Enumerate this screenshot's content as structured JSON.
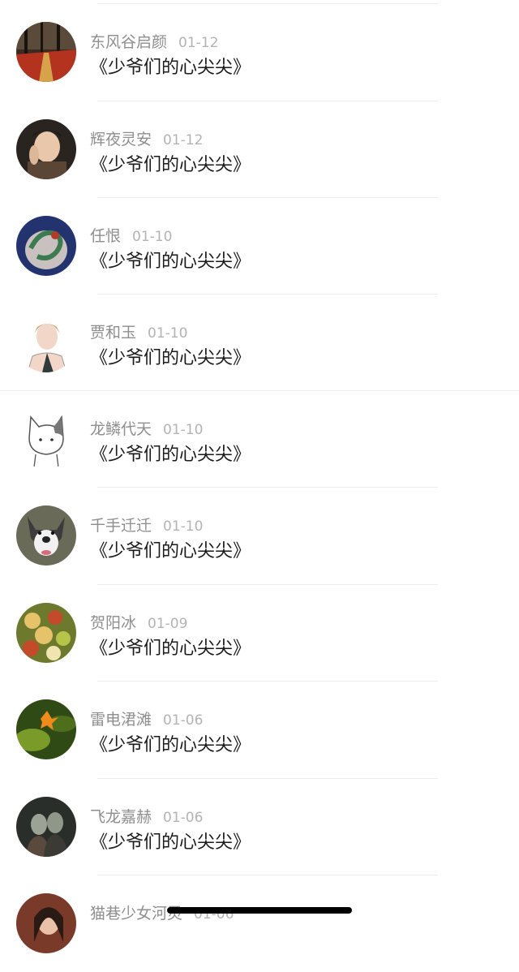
{
  "comments": [
    {
      "name": "东风谷启颜",
      "date": "01-12",
      "title": "《少爷们的心尖尖》",
      "avatar": "autumn-path-avatar",
      "colors": [
        "#3b2a1f",
        "#b3331f",
        "#d7a34a"
      ]
    },
    {
      "name": "辉夜灵安",
      "date": "01-12",
      "title": "《少爷们的心尖尖》",
      "avatar": "man-portrait-avatar",
      "colors": [
        "#2a2420",
        "#e8c7aa",
        "#5b4636"
      ]
    },
    {
      "name": "任恨",
      "date": "01-10",
      "title": "《少爷们的心尖尖》",
      "avatar": "dragon-ornament-avatar",
      "colors": [
        "#23336f",
        "#c8c1c0",
        "#3c7a4f"
      ]
    },
    {
      "name": "贾和玉",
      "date": "01-10",
      "title": "《少爷们的心尖尖》",
      "avatar": "anime-boy-avatar",
      "colors": [
        "#ffffff",
        "#cfa77e",
        "#f2d7c8"
      ]
    },
    {
      "name": "龙鳞代天",
      "date": "01-10",
      "title": "《少爷们的心尖尖》",
      "avatar": "cat-sketch-avatar",
      "colors": [
        "#ffffff",
        "#777777",
        "#cfcfcf"
      ]
    },
    {
      "name": "千手迁迁",
      "date": "01-10",
      "title": "《少爷们的心尖尖》",
      "avatar": "husky-dog-avatar",
      "colors": [
        "#6a6a58",
        "#f1f1f1",
        "#3b3b3b"
      ]
    },
    {
      "name": "贺阳冰",
      "date": "01-09",
      "title": "《少爷们的心尖尖》",
      "avatar": "food-platter-avatar",
      "colors": [
        "#6d7a2e",
        "#e6c36a",
        "#c44a2c"
      ]
    },
    {
      "name": "雷电涒滩",
      "date": "01-06",
      "title": "《少爷们的心尖尖》",
      "avatar": "green-leaf-avatar",
      "colors": [
        "#2f4a14",
        "#7a9a2a",
        "#f08a1b"
      ]
    },
    {
      "name": "飞龙嘉赫",
      "date": "01-06",
      "title": "《少爷们的心尖尖》",
      "avatar": "couple-photo-avatar",
      "colors": [
        "#2a2e2b",
        "#9aa394",
        "#5a4a3e"
      ]
    },
    {
      "name": "猫巷少女河灵",
      "date": "01-06",
      "title": "",
      "avatar": "girl-photo-avatar",
      "colors": [
        "#7a3a2a",
        "#e8c1a8",
        "#2a1a14"
      ]
    }
  ]
}
